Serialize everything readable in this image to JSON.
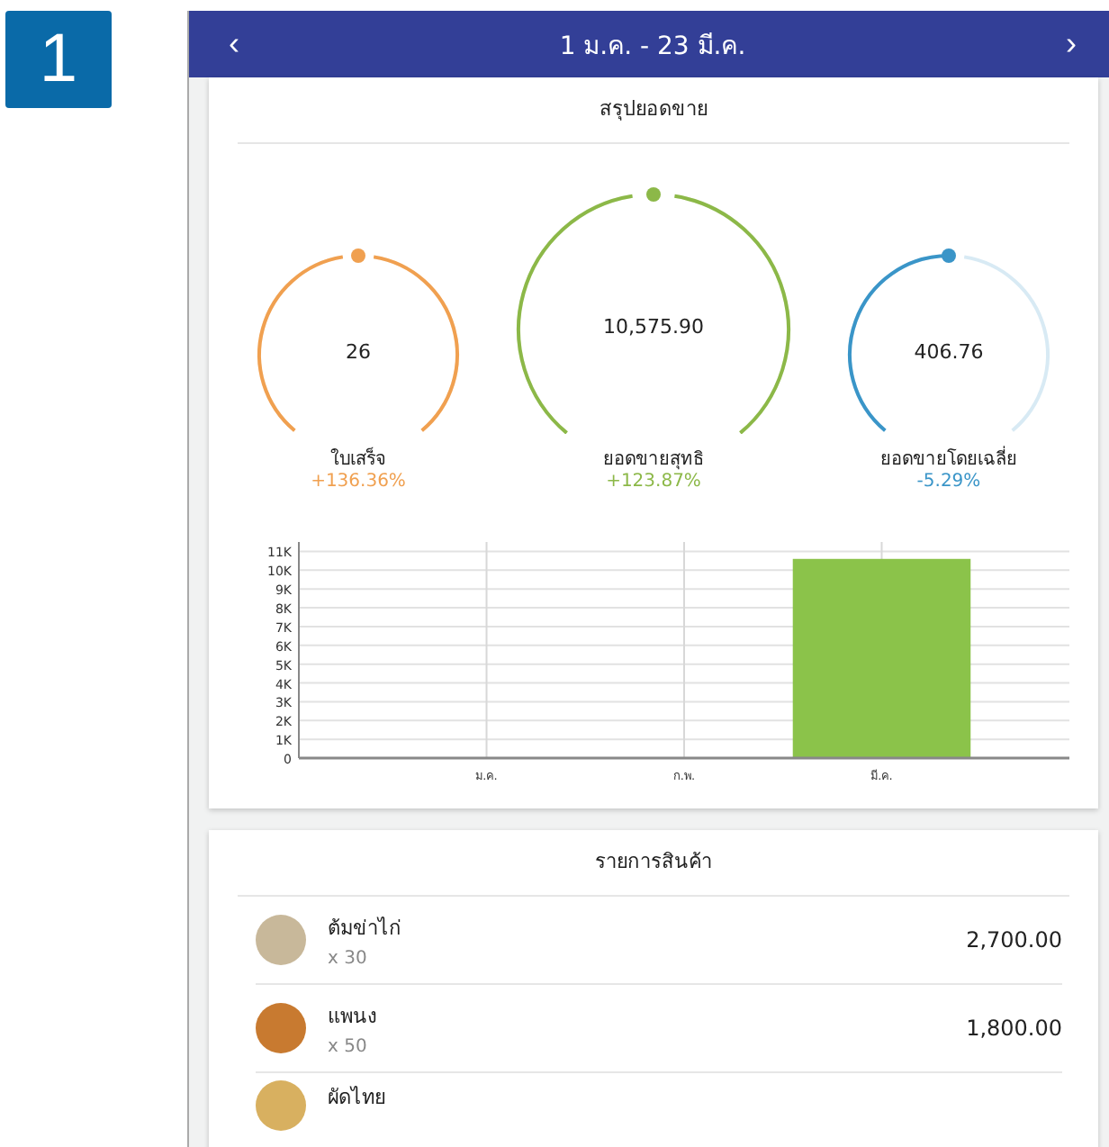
{
  "badge": "1",
  "header": {
    "prev": "‹",
    "title": "1 ม.ค. - 23 มี.ค.",
    "next": "›"
  },
  "summary": {
    "title": "สรุปยอดขาย",
    "gauges": [
      {
        "value": "26",
        "label": "ใบเสร็จ",
        "change": "+136.36%",
        "level": 1,
        "color": "#f0a050"
      },
      {
        "value": "10,575.90",
        "label": "ยอดขายสุทธิ",
        "change": "+123.87%",
        "level": 1,
        "color": "#8cb848"
      },
      {
        "value": "406.76",
        "label": "ยอดขายโดยเฉลี่ย",
        "change": "-5.29%",
        "level": 0.5,
        "color": "#3a95c8"
      }
    ],
    "chart_data": {
      "type": "bar",
      "categories": [
        "ม.ค.",
        "ก.พ.",
        "มี.ค."
      ],
      "values": [
        0,
        0,
        10600
      ],
      "ylim": [
        0,
        11500
      ],
      "grid": true,
      "yticks": [
        {
          "value": 0,
          "label": "0"
        },
        {
          "value": 1000,
          "label": "1K"
        },
        {
          "value": 2000,
          "label": "2K"
        },
        {
          "value": 3000,
          "label": "3K"
        },
        {
          "value": 4000,
          "label": "4K"
        },
        {
          "value": 5000,
          "label": "5K"
        },
        {
          "value": 6000,
          "label": "6K"
        },
        {
          "value": 7000,
          "label": "7K"
        },
        {
          "value": 8000,
          "label": "8K"
        },
        {
          "value": 9000,
          "label": "9K"
        },
        {
          "value": 10000,
          "label": "10K"
        },
        {
          "value": 11000,
          "label": "11K"
        }
      ]
    }
  },
  "products": {
    "title": "รายการสินค้า",
    "items": [
      {
        "name": "ต้มข่าไก่",
        "quantity": "x 30",
        "price": "2,700.00",
        "color": "#c8b89a"
      },
      {
        "name": "แพนง",
        "quantity": "x 50",
        "price": "1,800.00",
        "color": "#c87a30"
      },
      {
        "name": "ผัดไทย",
        "color": "#d8b060"
      }
    ]
  }
}
